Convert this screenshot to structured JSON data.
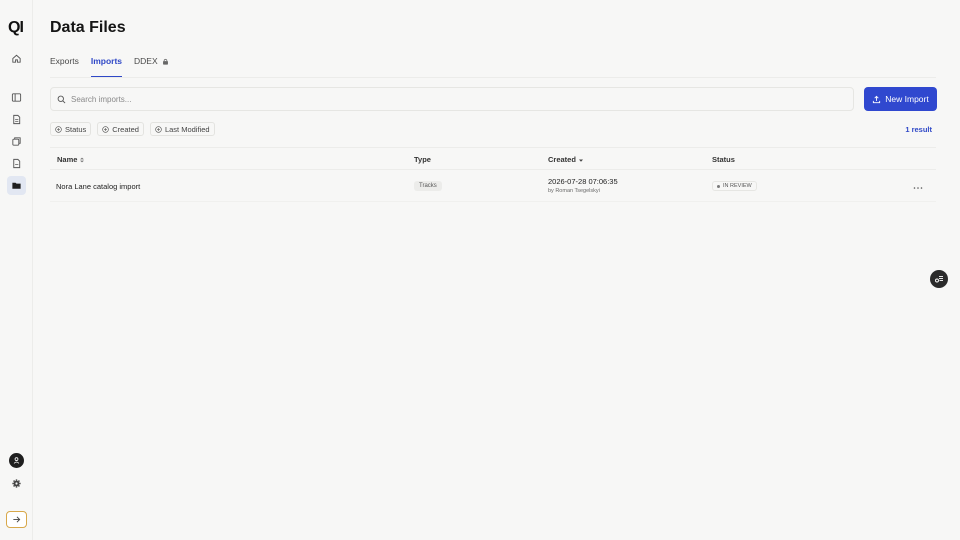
{
  "app": {
    "logo_text": "QI"
  },
  "sidebar": {
    "items": [
      {
        "name": "home-icon",
        "active": false
      },
      {
        "name": "catalog-icon",
        "active": false
      },
      {
        "name": "document-icon",
        "active": false
      },
      {
        "name": "stack-icon",
        "active": false
      },
      {
        "name": "file-icon",
        "active": false
      },
      {
        "name": "folder-icon",
        "active": true
      }
    ]
  },
  "page": {
    "title": "Data Files"
  },
  "tabs": [
    {
      "label": "Exports",
      "active": false
    },
    {
      "label": "Imports",
      "active": true
    },
    {
      "label": "DDEX",
      "active": false,
      "locked": true
    }
  ],
  "search": {
    "placeholder": "Search imports...",
    "value": ""
  },
  "actions": {
    "new_import_label": "New Import"
  },
  "filters": [
    {
      "label": "Status"
    },
    {
      "label": "Created"
    },
    {
      "label": "Last Modified"
    }
  ],
  "results": {
    "count_label": "1 result"
  },
  "table": {
    "columns": {
      "name": "Name",
      "type": "Type",
      "created": "Created",
      "status": "Status"
    },
    "rows": [
      {
        "name": "Nora Lane catalog import",
        "type": "Tracks",
        "created_date": "2026-07-28 07:06:35",
        "created_by": "by Roman Tsegelskyi",
        "status": "IN REVIEW"
      }
    ]
  },
  "colors": {
    "accent": "#3048cf",
    "background": "#f7f7f6",
    "expand_border": "#d8a84a"
  }
}
